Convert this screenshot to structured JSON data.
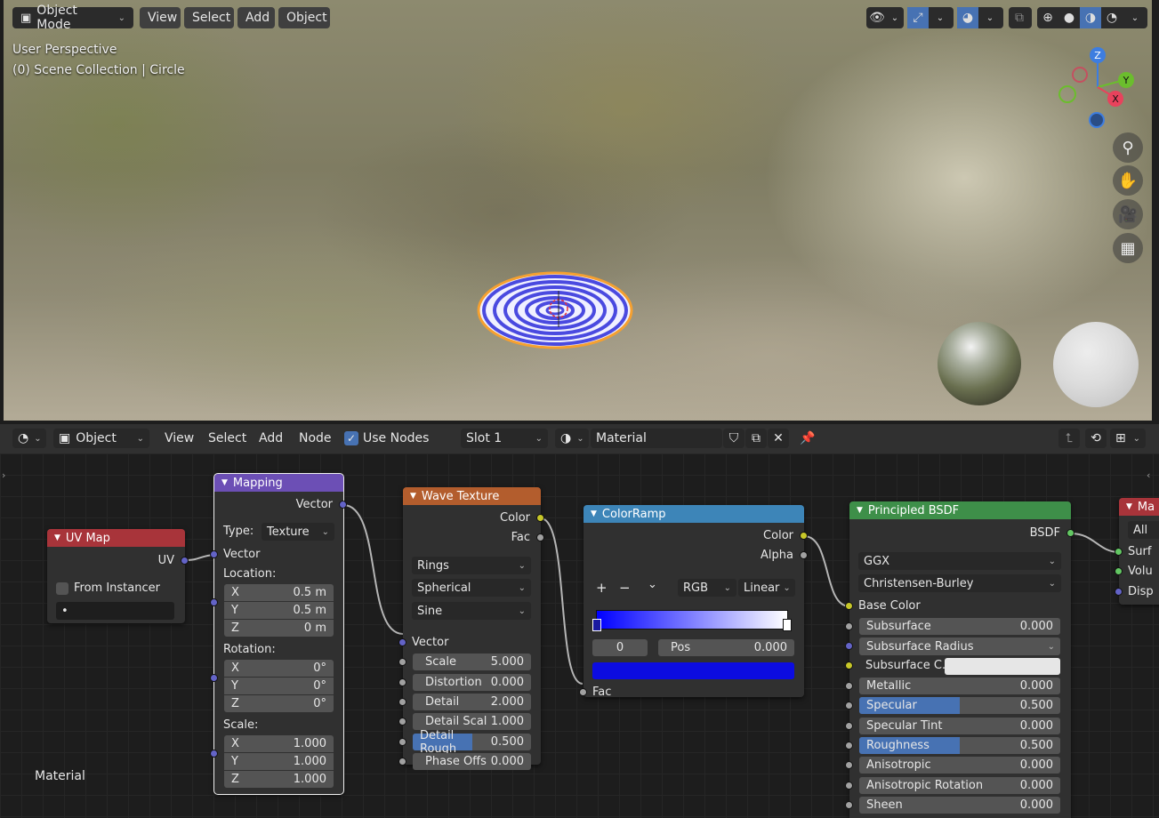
{
  "viewport": {
    "mode": "Object Mode",
    "menu": [
      "View",
      "Select",
      "Add",
      "Object"
    ],
    "overlay_line1": "User Perspective",
    "overlay_line2": "(0) Scene Collection | Circle",
    "gizmo": {
      "z": "Z",
      "y": "Y",
      "x": "X"
    },
    "icons": {
      "zoom": "zoom-icon",
      "pan": "hand-icon",
      "camera": "camera-icon",
      "ortho": "grid-icon"
    }
  },
  "node_header": {
    "editor_type": "Object",
    "menu": [
      "View",
      "Select",
      "Add",
      "Node"
    ],
    "use_nodes_label": "Use Nodes",
    "use_nodes_checked": true,
    "slot": "Slot 1",
    "material_name": "Material"
  },
  "footer_label": "Material",
  "nodes": {
    "uvmap": {
      "title": "UV Map",
      "output": "UV",
      "from_instancer": "From Instancer",
      "field": "•"
    },
    "mapping": {
      "title": "Mapping",
      "output": "Vector",
      "type_label": "Type:",
      "type_value": "Texture",
      "input": "Vector",
      "location_label": "Location:",
      "loc": [
        {
          "axis": "X",
          "val": "0.5 m"
        },
        {
          "axis": "Y",
          "val": "0.5 m"
        },
        {
          "axis": "Z",
          "val": "0 m"
        }
      ],
      "rotation_label": "Rotation:",
      "rot": [
        {
          "axis": "X",
          "val": "0°"
        },
        {
          "axis": "Y",
          "val": "0°"
        },
        {
          "axis": "Z",
          "val": "0°"
        }
      ],
      "scale_label": "Scale:",
      "scale": [
        {
          "axis": "X",
          "val": "1.000"
        },
        {
          "axis": "Y",
          "val": "1.000"
        },
        {
          "axis": "Z",
          "val": "1.000"
        }
      ]
    },
    "wave": {
      "title": "Wave Texture",
      "out_color": "Color",
      "out_fac": "Fac",
      "type": "Rings",
      "direction": "Spherical",
      "profile": "Sine",
      "input": "Vector",
      "params": [
        {
          "label": "Scale",
          "val": "5.000"
        },
        {
          "label": "Distortion",
          "val": "0.000"
        },
        {
          "label": "Detail",
          "val": "2.000"
        },
        {
          "label": "Detail Scal",
          "val": "1.000"
        },
        {
          "label": "Detail Rough",
          "val": "0.500"
        },
        {
          "label": "Phase Offs",
          "val": "0.000"
        }
      ]
    },
    "ramp": {
      "title": "ColorRamp",
      "out_color": "Color",
      "out_alpha": "Alpha",
      "plus": "+",
      "minus": "−",
      "more": "⌄",
      "mode": "RGB",
      "interp": "Linear",
      "index": "0",
      "pos_label": "Pos",
      "pos_val": "0.000",
      "input": "Fac",
      "color_left": "#0000ff",
      "color_right": "#ffffff"
    },
    "bsdf": {
      "title": "Principled BSDF",
      "output": "BSDF",
      "distribution": "GGX",
      "subsurface_method": "Christensen-Burley",
      "base_color": "Base Color",
      "params": [
        {
          "label": "Subsurface",
          "val": "0.000"
        },
        {
          "label": "Subsurface Radius",
          "val": ""
        },
        {
          "label": "Subsurface C...",
          "val": ""
        },
        {
          "label": "Metallic",
          "val": "0.000"
        },
        {
          "label": "Specular",
          "val": "0.500"
        },
        {
          "label": "Specular Tint",
          "val": "0.000"
        },
        {
          "label": "Roughness",
          "val": "0.500"
        },
        {
          "label": "Anisotropic",
          "val": "0.000"
        },
        {
          "label": "Anisotropic Rotation",
          "val": "0.000"
        },
        {
          "label": "Sheen",
          "val": "0.000"
        }
      ]
    },
    "output": {
      "title": "Ma",
      "target": "All",
      "inputs": [
        "Surf",
        "Volu",
        "Disp"
      ]
    }
  },
  "colors": {
    "accent": "#4772b3",
    "uv_header": "#a8343a",
    "mapping_header": "#6c4fb5",
    "wave_header": "#b35d2d",
    "ramp_header": "#3d85b8",
    "bsdf_header": "#3e8f49"
  }
}
